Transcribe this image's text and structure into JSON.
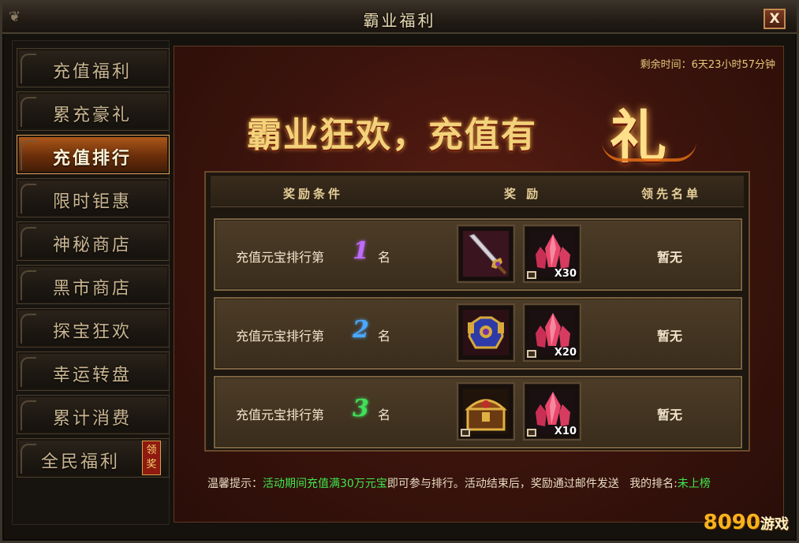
{
  "window": {
    "title": "霸业福利",
    "close_label": "X"
  },
  "sidebar": {
    "items": [
      {
        "label": "充值福利"
      },
      {
        "label": "累充豪礼"
      },
      {
        "label": "充值排行",
        "active": true
      },
      {
        "label": "限时钜惠"
      },
      {
        "label": "神秘商店"
      },
      {
        "label": "黑市商店"
      },
      {
        "label": "探宝狂欢"
      },
      {
        "label": "幸运转盘"
      },
      {
        "label": "累计消费"
      },
      {
        "label": "全民福利",
        "badge": "领奖"
      }
    ]
  },
  "main": {
    "timer": "剩余时间：6天23小时57分钟",
    "banner": {
      "text": "霸业狂欢，充值有",
      "big": "礼"
    },
    "table": {
      "headers": {
        "condition": "奖励条件",
        "reward": "奖 励",
        "leader": "领先名单"
      },
      "rows": [
        {
          "prefix": "充值元宝排行第",
          "rank": "1",
          "rank_color": "#c06bff",
          "suffix": "名",
          "item1_icon": "sword-icon",
          "item2_icon": "red-crystal-icon",
          "qty": "X30",
          "leader": "暂无"
        },
        {
          "prefix": "充值元宝排行第",
          "rank": "2",
          "rank_color": "#4aa8ff",
          "suffix": "名",
          "item1_icon": "armor-icon",
          "item2_icon": "red-crystal-icon",
          "qty": "X20",
          "leader": "暂无"
        },
        {
          "prefix": "充值元宝排行第",
          "rank": "3",
          "rank_color": "#3fe05a",
          "suffix": "名",
          "item1_icon": "treasure-chest-icon",
          "item2_icon": "red-crystal-icon",
          "qty": "X10",
          "leader": "暂无"
        }
      ]
    },
    "tip": {
      "prefix": "温馨提示：",
      "highlight": "活动期间充值满30万元宝",
      "middle": "即可参与排行。活动结束后，奖励通过邮件发送",
      "rank_label": "我的排名:",
      "rank_value": "未上榜"
    }
  },
  "watermark": {
    "brand": "8090",
    "suffix": "游戏"
  }
}
